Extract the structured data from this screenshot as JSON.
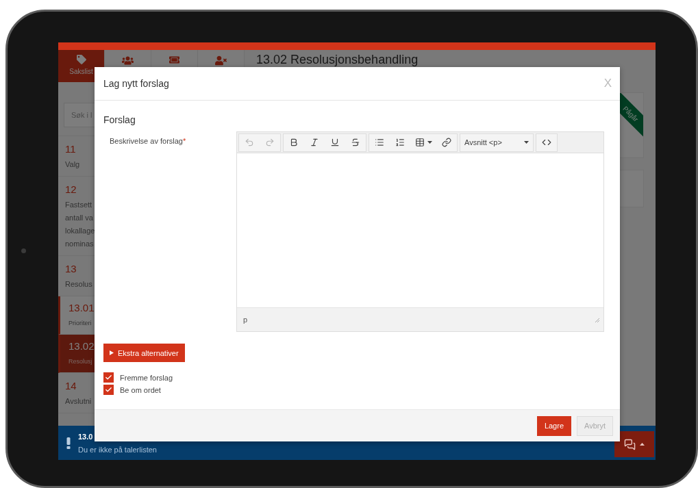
{
  "nav_tabs": [
    {
      "kind": "tag",
      "label": "Sakslist",
      "selected": true
    },
    {
      "kind": "users",
      "selected": false
    },
    {
      "kind": "ticket",
      "selected": false
    },
    {
      "kind": "user-x",
      "selected": false
    }
  ],
  "page_title": "13.02 Resolusjonsbehandling",
  "sidebar": {
    "search_placeholder": "Søk i l",
    "items": [
      {
        "kind": "main",
        "number": "11",
        "lines": [
          "Valg"
        ],
        "selected": false
      },
      {
        "kind": "main",
        "number": "12",
        "lines": [
          "Fastsett",
          "antall va",
          "lokallage",
          "nominas"
        ],
        "selected": false
      },
      {
        "kind": "main",
        "number": "13",
        "lines": [
          "Resolus"
        ],
        "selected": false
      },
      {
        "kind": "sub",
        "number": "13.01",
        "lines": [
          "Prioriteri"
        ],
        "selected": false
      },
      {
        "kind": "sub",
        "number": "13.02",
        "lines": [
          "Resolusj"
        ],
        "selected": true
      },
      {
        "kind": "main",
        "number": "14",
        "lines": [
          "Avslutni"
        ],
        "selected": false
      }
    ]
  },
  "status_ribbon": "Pågår",
  "modal": {
    "title": "Lag nytt forslag",
    "close": "X",
    "section": "Forslag",
    "field_label": "Beskrivelse av forslag",
    "required_mark": "*",
    "editor": {
      "toolbar_groups": [
        {
          "buttons": [
            {
              "kind": "undo",
              "disabled": true
            },
            {
              "kind": "redo",
              "disabled": true
            }
          ]
        },
        {
          "buttons": [
            {
              "kind": "bold",
              "disabled": false
            },
            {
              "kind": "italic",
              "disabled": false
            },
            {
              "kind": "underline",
              "disabled": false
            },
            {
              "kind": "strike",
              "disabled": false
            }
          ]
        },
        {
          "buttons": [
            {
              "kind": "bullets",
              "disabled": false
            },
            {
              "kind": "numbers",
              "disabled": false
            },
            {
              "kind": "table",
              "disabled": false
            },
            {
              "kind": "link",
              "disabled": false
            }
          ]
        },
        {
          "buttons": [
            {
              "kind": "format",
              "label": "Avsnitt <p>",
              "disabled": false
            }
          ]
        },
        {
          "buttons": [
            {
              "kind": "code",
              "disabled": false
            }
          ]
        }
      ],
      "status_path": "p"
    },
    "extra_button": "Ekstra alternativer",
    "checkboxes": [
      {
        "label": "Fremme forslag",
        "checked": true
      },
      {
        "label": "Be om ordet",
        "checked": true
      }
    ],
    "buttons": [
      {
        "label": "Lagre",
        "kind": "primary"
      },
      {
        "label": "Avbryt",
        "kind": "secondary"
      }
    ]
  },
  "notice": {
    "item": "13.0",
    "text": "Du er ikke på talerlisten"
  }
}
